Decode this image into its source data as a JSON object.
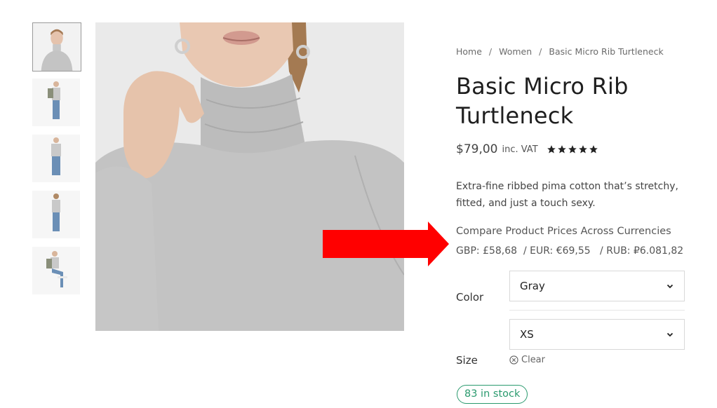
{
  "colors": {
    "accent_arrow": "#ff0000",
    "stock_green": "#2a9a6e",
    "sweater_gray": "#bdbdbd"
  },
  "gallery": {
    "thumbnails": [
      {
        "name": "thumb-closeup",
        "active": true
      },
      {
        "name": "thumb-full-jacket",
        "active": false
      },
      {
        "name": "thumb-full-front",
        "active": false
      },
      {
        "name": "thumb-full-back",
        "active": false
      },
      {
        "name": "thumb-seated",
        "active": false
      }
    ]
  },
  "breadcrumb": {
    "home": "Home",
    "sep": "/",
    "category": "Women",
    "current": "Basic Micro Rib Turtleneck"
  },
  "product": {
    "title": "Basic Micro Rib Turtleneck",
    "price": "$79,00",
    "vat": "inc. VAT",
    "rating": 5,
    "description": "Extra-fine ribbed pima cotton that’s stretchy, fitted, and just a touch sexy."
  },
  "currency": {
    "heading": "Compare Product Prices Across Currencies",
    "gbp": "GBP: £58,68",
    "eur": "/ EUR: €69,55",
    "rub": "/ RUB: ₽6.081,82"
  },
  "variants": {
    "color_label": "Color",
    "color_value": "Gray",
    "size_label": "Size",
    "size_value": "XS",
    "clear_label": "Clear"
  },
  "stock": {
    "label": "83 in stock"
  }
}
